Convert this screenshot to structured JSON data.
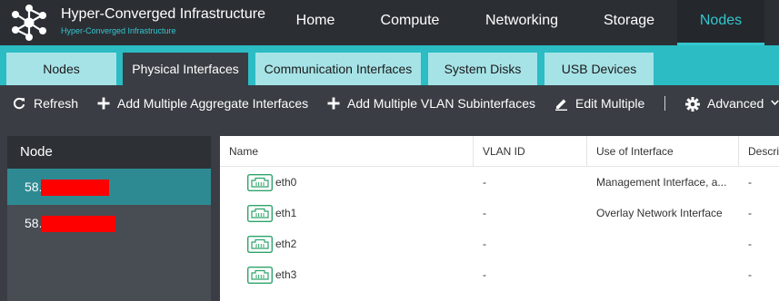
{
  "brand": {
    "title": "Hyper-Converged Infrastructure",
    "subtitle": "Hyper-Converged Infrastructure",
    "logo_icon": "network-hub-logo"
  },
  "nav": {
    "items": [
      {
        "label": "Home",
        "active": false
      },
      {
        "label": "Compute",
        "active": false
      },
      {
        "label": "Networking",
        "active": false
      },
      {
        "label": "Storage",
        "active": false
      },
      {
        "label": "Nodes",
        "active": true
      }
    ]
  },
  "tabs": [
    {
      "label": "Nodes",
      "active": false
    },
    {
      "label": "Physical Interfaces",
      "active": true
    },
    {
      "label": "Communication Interfaces",
      "active": false
    },
    {
      "label": "System Disks",
      "active": false
    },
    {
      "label": "USB Devices",
      "active": false
    }
  ],
  "toolbar": {
    "refresh": "Refresh",
    "add_aggregate": "Add Multiple Aggregate Interfaces",
    "add_vlan": "Add Multiple VLAN Subinterfaces",
    "edit_multiple": "Edit Multiple",
    "advanced": "Advanced"
  },
  "node_panel": {
    "header": "Node",
    "nodes": [
      {
        "prefix": "58.",
        "redacted": true,
        "selected": true
      },
      {
        "prefix": "58.",
        "redacted": true,
        "selected": false
      }
    ]
  },
  "grid": {
    "columns": [
      "Name",
      "VLAN ID",
      "Use of Interface",
      "Description"
    ],
    "rows": [
      {
        "name": "eth0",
        "vlan_id": "-",
        "use": "Management Interface, a...",
        "description": "-"
      },
      {
        "name": "eth1",
        "vlan_id": "-",
        "use": "Overlay Network Interface",
        "description": "-"
      },
      {
        "name": "eth2",
        "vlan_id": "-",
        "use": "",
        "description": "-"
      },
      {
        "name": "eth3",
        "vlan_id": "-",
        "use": "",
        "description": "-"
      }
    ]
  },
  "colors": {
    "accent": "#34c6cf",
    "topbar": "#2b2f34",
    "tabstrip": "#2bbcc4",
    "inactive_tab": "#a6e3e7",
    "toolbar": "#3a3e44",
    "selected_node": "#2e8a92",
    "nic_icon": "#2ea36b",
    "redaction": "#ff0000"
  }
}
